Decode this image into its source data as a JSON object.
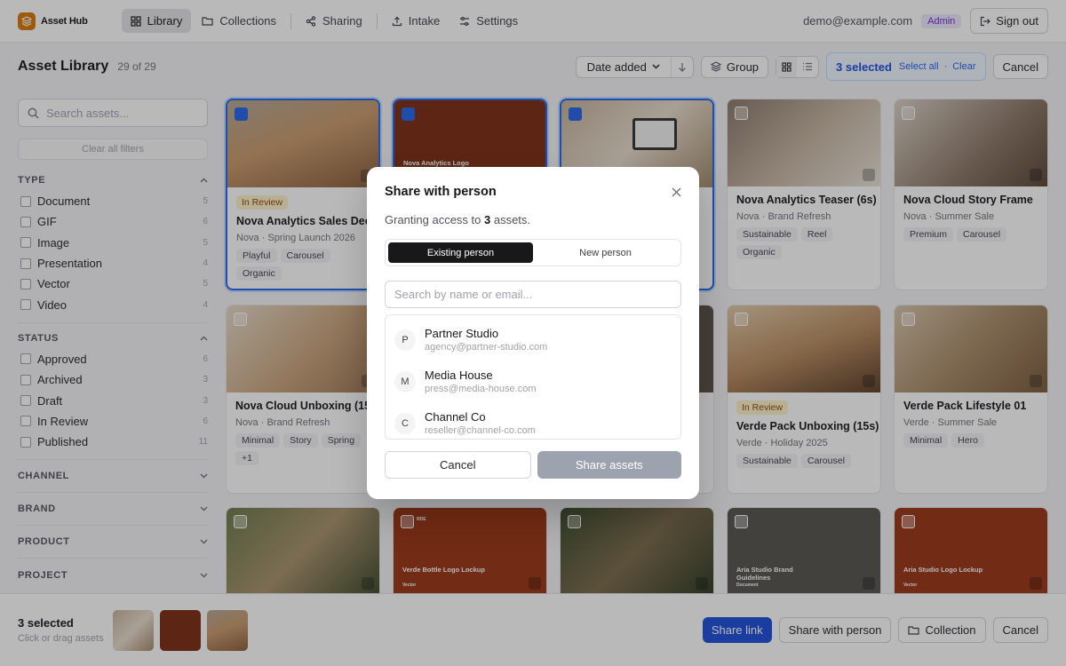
{
  "app": {
    "name": "Asset Hub"
  },
  "nav": [
    "Library",
    "Collections",
    "Sharing",
    "Intake",
    "Settings"
  ],
  "user": {
    "email": "demo@example.com",
    "role": "Admin",
    "signout": "Sign out"
  },
  "toolbar": {
    "title": "Asset Library",
    "count": "29 of 29",
    "sort": "Date added",
    "group": "Group",
    "selected": "3 selected",
    "select_all": "Select all",
    "dot": "·",
    "clear": "Clear",
    "cancel": "Cancel"
  },
  "sidebar": {
    "search_placeholder": "Search assets...",
    "clear_filters": "Clear all filters",
    "type": {
      "title": "TYPE",
      "items": [
        {
          "label": "Document",
          "count": "5"
        },
        {
          "label": "GIF",
          "count": "6"
        },
        {
          "label": "Image",
          "count": "5"
        },
        {
          "label": "Presentation",
          "count": "4"
        },
        {
          "label": "Vector",
          "count": "5"
        },
        {
          "label": "Video",
          "count": "4"
        }
      ]
    },
    "status": {
      "title": "STATUS",
      "items": [
        {
          "label": "Approved",
          "count": "6"
        },
        {
          "label": "Archived",
          "count": "3"
        },
        {
          "label": "Draft",
          "count": "3"
        },
        {
          "label": "In Review",
          "count": "6"
        },
        {
          "label": "Published",
          "count": "11"
        }
      ]
    },
    "collapsed": [
      "CHANNEL",
      "BRAND",
      "PRODUCT",
      "PROJECT"
    ]
  },
  "cards": [
    {
      "title": "Nova Analytics Sales Deck",
      "meta": "Nova · Spring Launch 2026",
      "badge": "In Review",
      "tags": [
        "Playful",
        "Carousel",
        "Organic"
      ]
    },
    {
      "title": "Nova Analytics Teaser (6s)",
      "meta": "Nova · Brand Refresh",
      "tags": [
        "Sustainable",
        "Reel",
        "Organic"
      ]
    },
    {
      "title": "Nova Cloud Story Frame",
      "meta": "Nova · Summer Sale",
      "tags": [
        "Premium",
        "Carousel"
      ]
    },
    {
      "title": "Nova Cloud Unboxing (15s)",
      "meta": "Nova · Brand Refresh",
      "tags": [
        "Minimal",
        "Story",
        "Spring",
        "+1"
      ]
    },
    {
      "title": "Verde Pack Unboxing (15s)",
      "meta": "Verde · Holiday 2025",
      "badge": "In Review",
      "tags": [
        "Sustainable",
        "Carousel"
      ]
    },
    {
      "title": "Verde Pack Lifestyle 01",
      "meta": "Verde · Summer Sale",
      "tags": [
        "Minimal",
        "Hero"
      ]
    }
  ],
  "card_overlays": {
    "nova_logo": "Nova Analytics Logo",
    "verde_logo": "Verde Bottle Logo Lockup",
    "verde_vector": "Vector",
    "aria_brand": "Aria Studio Brand Guidelines",
    "aria_doc": "Document",
    "aria_logo": "Aria Studio Logo Lockup",
    "aria_vector": "Vector",
    "verde_label": "RDE"
  },
  "bottom": {
    "selected": "3 selected",
    "hint": "Click or drag assets",
    "share_link": "Share link",
    "share_person": "Share with person",
    "collection": "Collection",
    "cancel": "Cancel"
  },
  "modal": {
    "title": "Share with person",
    "desc_pre": "Granting access to ",
    "desc_count": "3",
    "desc_post": " assets.",
    "tab_existing": "Existing person",
    "tab_new": "New person",
    "search_placeholder": "Search by name or email...",
    "people": [
      {
        "initial": "P",
        "name": "Partner Studio",
        "email": "agency@partner-studio.com"
      },
      {
        "initial": "M",
        "name": "Media House",
        "email": "press@media-house.com"
      },
      {
        "initial": "C",
        "name": "Channel Co",
        "email": "reseller@channel-co.com"
      }
    ],
    "cancel": "Cancel",
    "share": "Share assets"
  }
}
